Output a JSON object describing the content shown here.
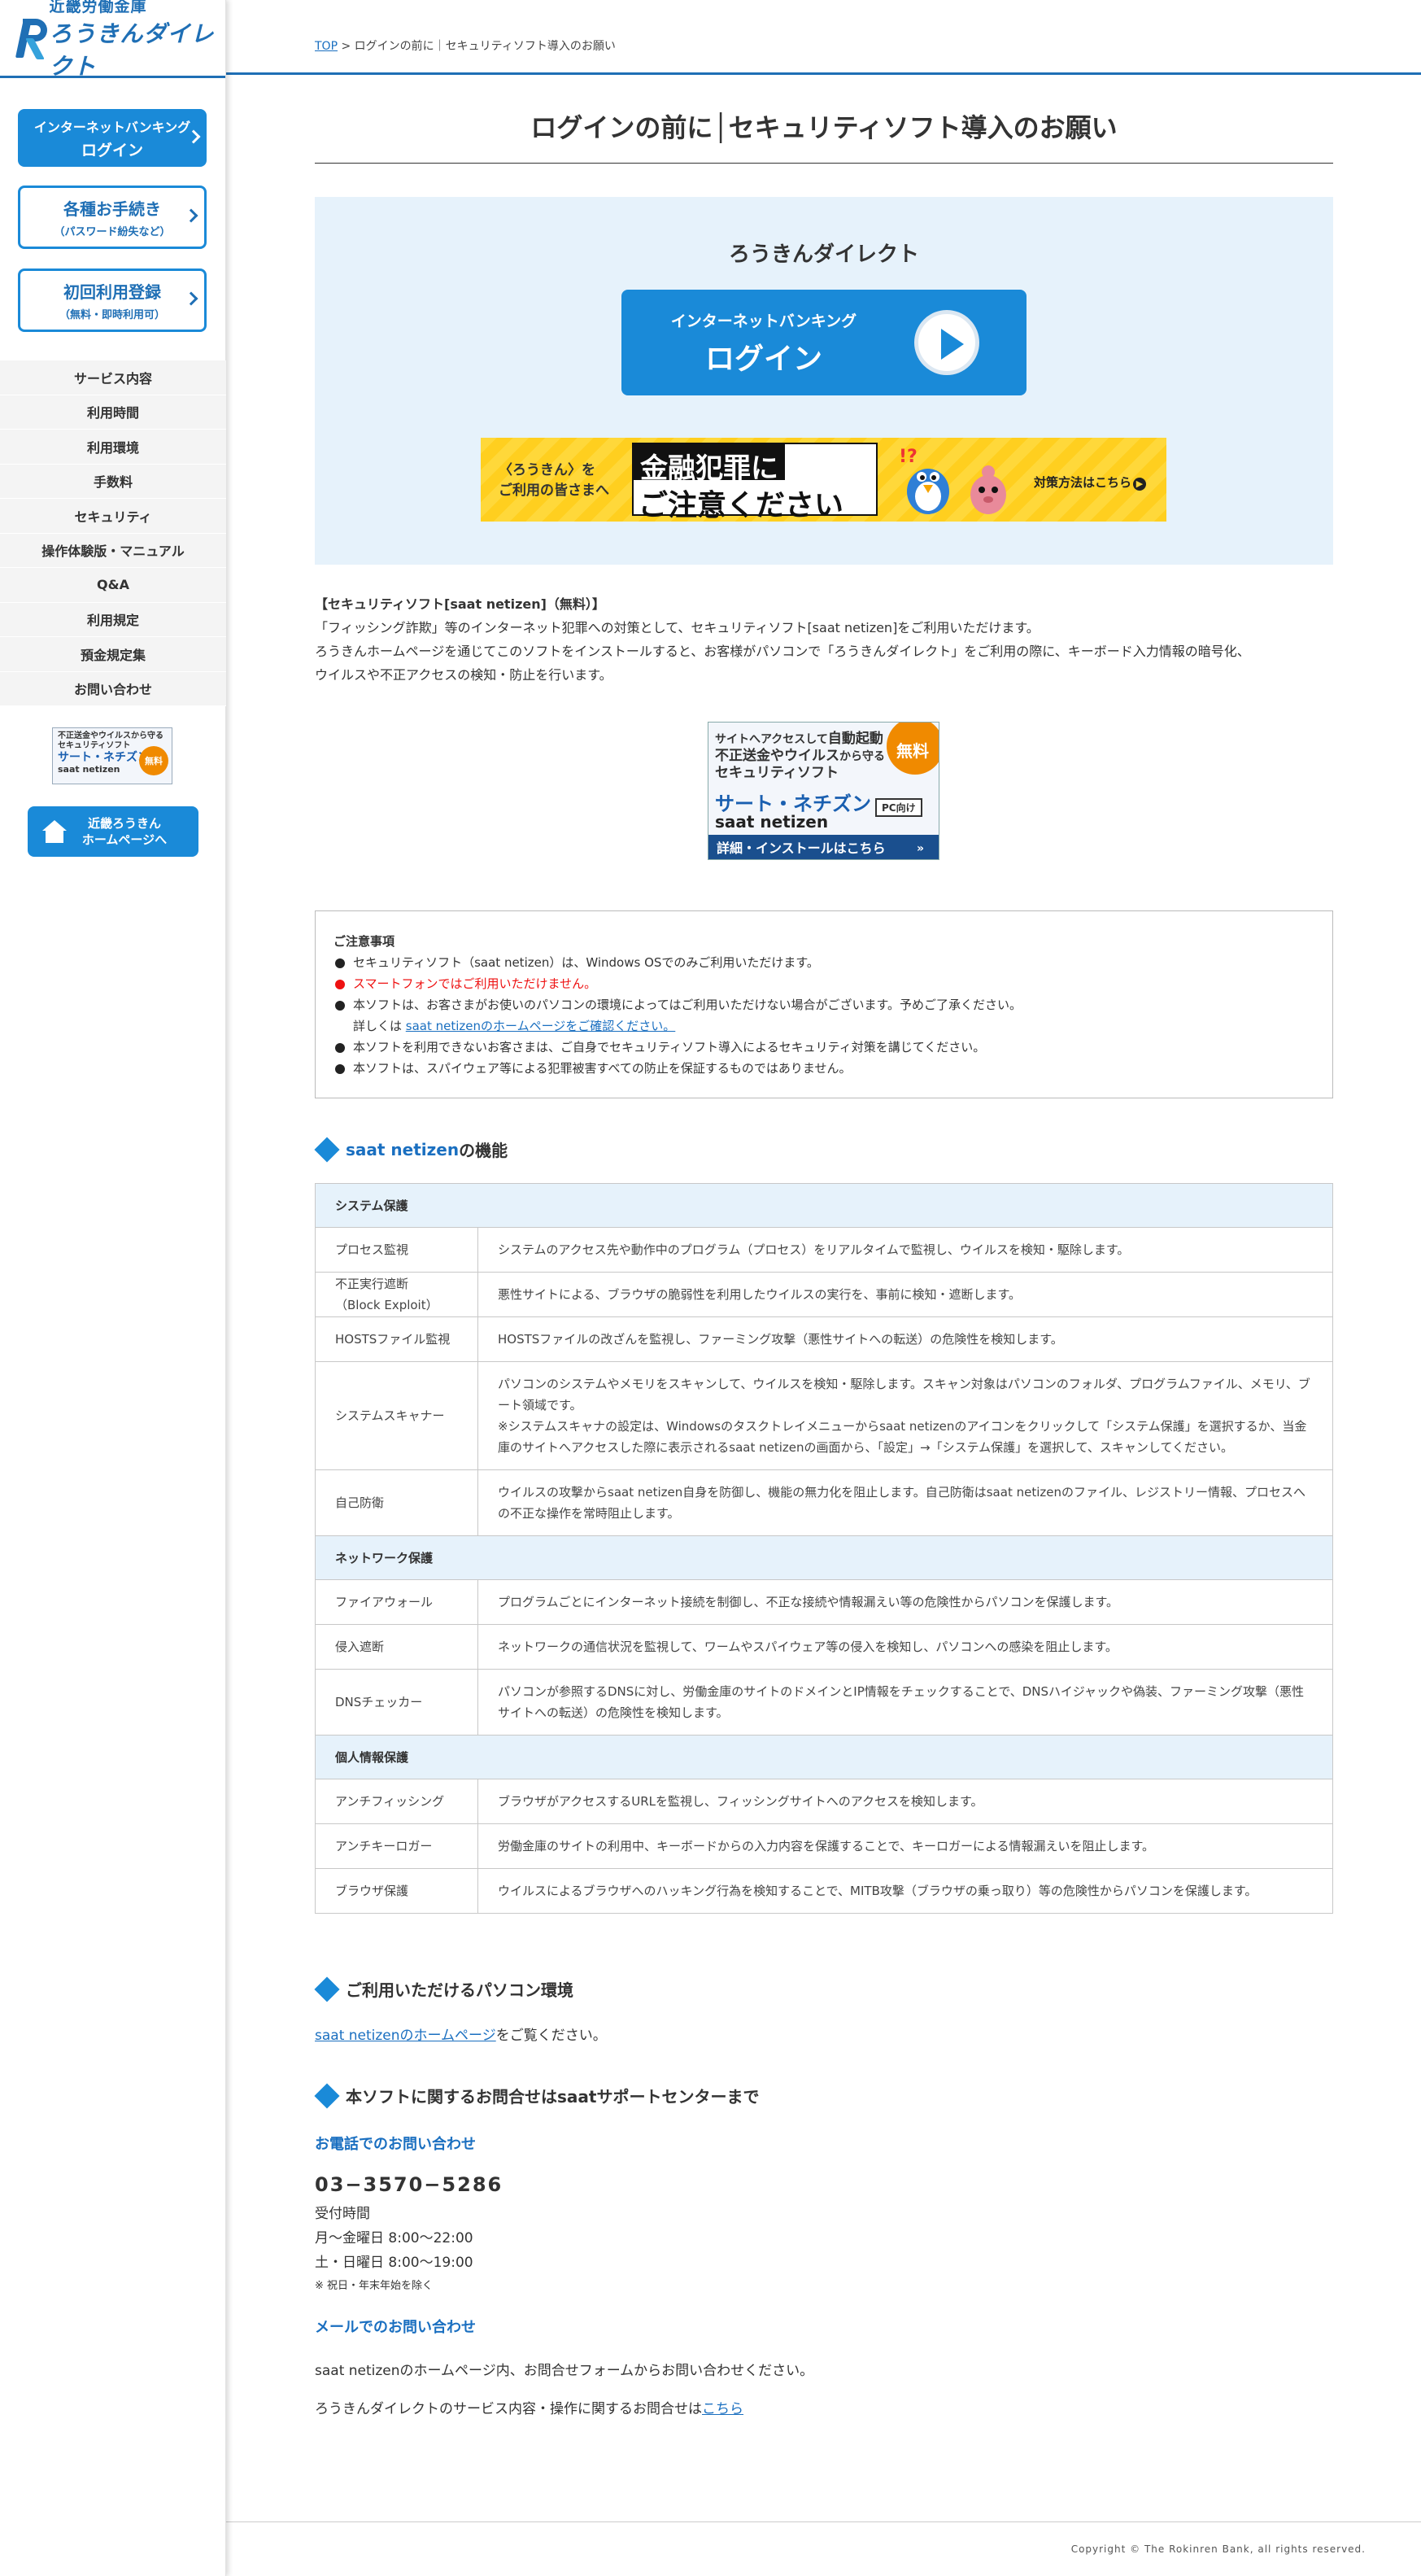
{
  "sidebar": {
    "logo_sub": "近畿労働金庫",
    "logo_main": "ろうきんダイレクト",
    "login_btn": {
      "line1": "インターネットバンキング",
      "line2": "ログイン"
    },
    "procedures_btn": {
      "line1": "各種お手続き",
      "line2": "（パスワード紛失など）"
    },
    "register_btn": {
      "line1": "初回利用登録",
      "line2": "（無料・即時利用可）"
    },
    "menu": [
      "サービス内容",
      "利用時間",
      "利用環境",
      "手数料",
      "セキュリティ",
      "操作体験版・マニュアル",
      "Q&A",
      "利用規定",
      "預金規定集",
      "お問い合わせ"
    ],
    "saat_banner": {
      "t1": "不正送金やウイルスから守る",
      "t1b": "セキュリティソフト",
      "t2": "サート・ネチズン",
      "t3": "saat netizen",
      "free": "無料"
    },
    "home_btn": {
      "line1": "近畿ろうきん",
      "line2": "ホームページへ"
    }
  },
  "breadcrumb": {
    "top": "TOP",
    "sep": ">",
    "current": "ログインの前に｜セキュリティソフト導入のお願い"
  },
  "page_title": "ログインの前に│セキュリティソフト導入のお願い",
  "login_panel": {
    "brand": "ろうきんダイレクト",
    "btn_line1": "インターネットバンキング",
    "btn_line2": "ログイン"
  },
  "fraud_banner": {
    "left1": "〈ろうきん〉を",
    "left2": "ご利用の皆さまへ",
    "big1": "金融犯罪に",
    "big2": "ご注意ください",
    "more": "対策方法はこちら"
  },
  "intro": {
    "heading": "【セキュリティソフト[saat netizen]（無料）】",
    "p1": "「フィッシング詐欺」等のインターネット犯罪への対策として、セキュリティソフト[saat netizen]をご利用いただけます。",
    "p2": "ろうきんホームページを通じてこのソフトをインストールすると、お客様がパソコンで「ろうきんダイレクト」をご利用の際に、キーボード入力情報の暗号化、",
    "p3": "ウイルスや不正アクセスの検知・防止を行います。"
  },
  "saat_main_banner": {
    "s1a": "サイトへアクセスして",
    "s1b": "自動起動",
    "s1c": "不正送金やウイルス",
    "s1d": "から守る",
    "s1e": "セキュリティソフト",
    "s2": "サート・ネチズン",
    "s3": "saat netizen",
    "pc": "PC向け",
    "free": "無料",
    "bottom": "詳細・インストールはこちら",
    "bottom_arrow": "»"
  },
  "notes": {
    "title": "ご注意事項",
    "items": [
      "セキュリティソフト（saat netizen）は、Windows OSでのみご利用いただけます。",
      "スマートフォンではご利用いただけません。",
      "本ソフトは、お客さまがお使いのパソコンの環境によってはご利用いただけない場合がございます。予めご了承ください。",
      "本ソフトを利用できないお客さまは、ご自身でセキュリティソフト導入によるセキュリティ対策を講じてください。",
      "本ソフトは、スパイウェア等による犯罪被害すべての防止を保証するものではありません。"
    ],
    "detail_prefix": "詳しくは ",
    "detail_link": "saat netizenのホームページをご確認ください。"
  },
  "features": {
    "heading_blue": "saat netizen",
    "heading_rest": "の機能",
    "groups": [
      {
        "category": "システム保護",
        "rows": [
          {
            "name": "プロセス監視",
            "desc": "システムのアクセス先や動作中のプログラム（プロセス）をリアルタイムで監視し、ウイルスを検知・駆除します。"
          },
          {
            "name": "不正実行遮断\n（Block Exploit）",
            "desc": "悪性サイトによる、ブラウザの脆弱性を利用したウイルスの実行を、事前に検知・遮断します。"
          },
          {
            "name": "HOSTSファイル監視",
            "desc": "HOSTSファイルの改ざんを監視し、ファーミング攻撃（悪性サイトへの転送）の危険性を検知します。"
          },
          {
            "name": "システムスキャナー",
            "desc": "パソコンのシステムやメモリをスキャンして、ウイルスを検知・駆除します。スキャン対象はパソコンのフォルダ、プログラムファイル、メモリ、ブート領域です。\n※システムスキャナの設定は、Windowsのタスクトレイメニューからsaat netizenのアイコンをクリックして「システム保護」を選択するか、当金庫のサイトへアクセスした際に表示されるsaat netizenの画面から、「設定」→「システム保護」を選択して、スキャンしてください。"
          },
          {
            "name": "自己防衛",
            "desc": "ウイルスの攻撃からsaat netizen自身を防御し、機能の無力化を阻止します。自己防衛はsaat netizenのファイル、レジストリー情報、プロセスへの不正な操作を常時阻止します。"
          }
        ]
      },
      {
        "category": "ネットワーク保護",
        "rows": [
          {
            "name": "ファイアウォール",
            "desc": "プログラムごとにインターネット接続を制御し、不正な接続や情報漏えい等の危険性からパソコンを保護します。"
          },
          {
            "name": "侵入遮断",
            "desc": "ネットワークの通信状況を監視して、ワームやスパイウェア等の侵入を検知し、パソコンへの感染を阻止します。"
          },
          {
            "name": "DNSチェッカー",
            "desc": "パソコンが参照するDNSに対し、労働金庫のサイトのドメインとIP情報をチェックすることで、DNSハイジャックや偽装、ファーミング攻撃（悪性サイトへの転送）の危険性を検知します。"
          }
        ]
      },
      {
        "category": "個人情報保護",
        "rows": [
          {
            "name": "アンチフィッシング",
            "desc": "ブラウザがアクセスするURLを監視し、フィッシングサイトへのアクセスを検知します。"
          },
          {
            "name": "アンチキーロガー",
            "desc": "労働金庫のサイトの利用中、キーボードからの入力内容を保護することで、キーロガーによる情報漏えいを阻止します。"
          },
          {
            "name": "ブラウザ保護",
            "desc": "ウイルスによるブラウザへのハッキング行為を検知することで、MITB攻撃（ブラウザの乗っ取り）等の危険性からパソコンを保護します。"
          }
        ]
      }
    ]
  },
  "env": {
    "heading": "ご利用いただけるパソコン環境",
    "link": "saat netizenのホームページ",
    "suffix": "をご覧ください。"
  },
  "contact": {
    "heading": "本ソフトに関するお問合せはsaatサポートセンターまで",
    "phone_h": "お電話でのお問い合わせ",
    "phone": "03−3570−5286",
    "hours_label": "受付時間",
    "weekday": "月～金曜日 8:00～22:00",
    "weekend": "土・日曜日 8:00～19:00",
    "note": "※ 祝日・年末年始を除く",
    "mail_h": "メールでのお問い合わせ",
    "mail_text": "saat netizenのホームページ内、お問合せフォームからお問い合わせください。",
    "service_text": "ろうきんダイレクトのサービス内容・操作に関するお問合せは",
    "service_link": "こちら"
  },
  "copyright": "Copyright © The Rokinren Bank, all rights reserved."
}
